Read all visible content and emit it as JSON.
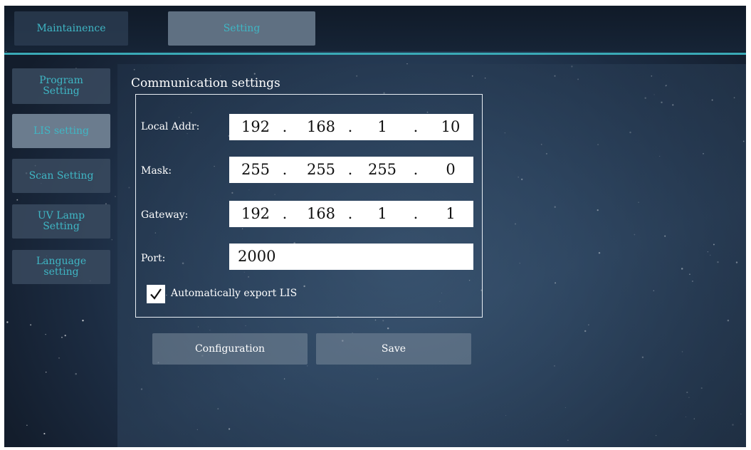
{
  "tabs": [
    {
      "label": "Maintainence"
    },
    {
      "label": "Setting"
    }
  ],
  "sidebar": {
    "items": [
      {
        "label": "Program\nSetting"
      },
      {
        "label": "LIS setting"
      },
      {
        "label": "Scan Setting"
      },
      {
        "label": "UV Lamp\nSetting"
      },
      {
        "label": "Language\nsetting"
      }
    ]
  },
  "main": {
    "title": "Communication settings",
    "local_addr": {
      "label": "Local Addr:",
      "octets": [
        "192",
        "168",
        "1",
        "10"
      ]
    },
    "mask": {
      "label": "Mask:",
      "octets": [
        "255",
        "255",
        "255",
        "0"
      ]
    },
    "gateway": {
      "label": "Gateway:",
      "octets": [
        "192",
        "168",
        "1",
        "1"
      ]
    },
    "port": {
      "label": "Port:",
      "value": "2000"
    },
    "auto_export": {
      "label": "Automatically export LIS",
      "checked": true
    },
    "dot": "."
  },
  "buttons": {
    "configuration": "Configuration",
    "save": "Save"
  },
  "colors": {
    "accent": "#3aa9b6",
    "tab_text": "#3fb7c5"
  }
}
